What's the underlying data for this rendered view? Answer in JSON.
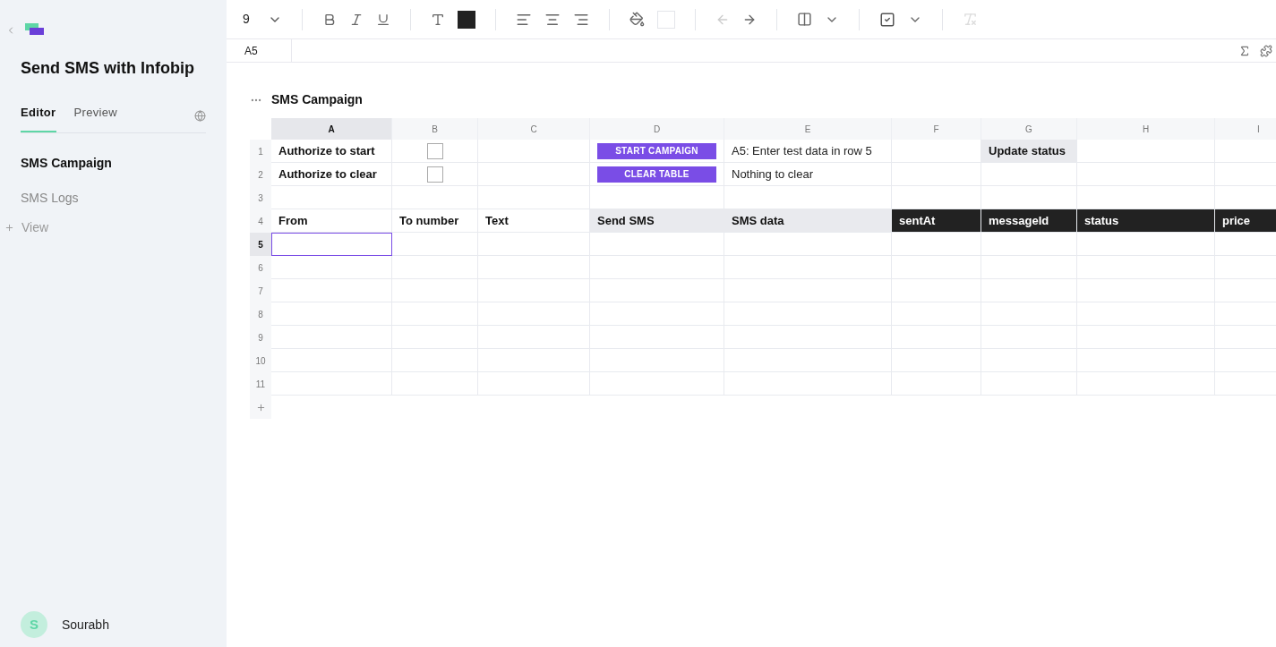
{
  "sidebar": {
    "title": "Send SMS with Infobip",
    "tabs": [
      {
        "label": "Editor",
        "selected": true
      },
      {
        "label": "Preview",
        "selected": false
      }
    ],
    "pages": [
      {
        "label": "SMS Campaign",
        "selected": true
      },
      {
        "label": "SMS Logs",
        "selected": false
      }
    ],
    "add_view": "View",
    "user": {
      "initial": "S",
      "name": "Sourabh"
    }
  },
  "toolbar": {
    "font_size": "9"
  },
  "formula_bar": {
    "cell_ref": "A5"
  },
  "sheet": {
    "title": "SMS Campaign",
    "columns": [
      {
        "label": "A",
        "selected": true
      },
      {
        "label": "B",
        "selected": false
      },
      {
        "label": "C",
        "selected": false
      },
      {
        "label": "D",
        "selected": false
      },
      {
        "label": "E",
        "selected": false
      },
      {
        "label": "F",
        "selected": false
      },
      {
        "label": "G",
        "selected": false
      },
      {
        "label": "H",
        "selected": false
      },
      {
        "label": "I",
        "selected": false
      }
    ],
    "rows": [
      {
        "number": "1",
        "selected": false,
        "cells": [
          {
            "kind": "bold",
            "text": "Authorize to start"
          },
          {
            "kind": "checkbox",
            "checked": false
          },
          {
            "kind": "plain"
          },
          {
            "kind": "button",
            "text": "START CAMPAIGN"
          },
          {
            "kind": "plain",
            "text": "A5: Enter test data in row 5"
          },
          {
            "kind": "plain"
          },
          {
            "kind": "shaded",
            "text": "Update status"
          },
          {
            "kind": "plain"
          },
          {
            "kind": "plain"
          }
        ]
      },
      {
        "number": "2",
        "selected": false,
        "cells": [
          {
            "kind": "bold",
            "text": "Authorize to clear"
          },
          {
            "kind": "checkbox",
            "checked": false
          },
          {
            "kind": "plain"
          },
          {
            "kind": "button",
            "text": "CLEAR TABLE"
          },
          {
            "kind": "plain",
            "text": "Nothing to clear"
          },
          {
            "kind": "plain"
          },
          {
            "kind": "plain"
          },
          {
            "kind": "plain"
          },
          {
            "kind": "plain"
          }
        ]
      },
      {
        "number": "3",
        "selected": false,
        "cells": []
      },
      {
        "number": "4",
        "selected": false,
        "cells": [
          {
            "kind": "bold",
            "text": "From"
          },
          {
            "kind": "bold",
            "text": "To number"
          },
          {
            "kind": "bold",
            "text": "Text"
          },
          {
            "kind": "shaded",
            "text": "Send SMS"
          },
          {
            "kind": "shaded",
            "text": "SMS data"
          },
          {
            "kind": "dark",
            "text": "sentAt"
          },
          {
            "kind": "dark",
            "text": "messageId"
          },
          {
            "kind": "dark",
            "text": "status"
          },
          {
            "kind": "dark",
            "text": "price"
          }
        ]
      },
      {
        "number": "5",
        "selected": true,
        "cells": [
          {
            "kind": "plain",
            "selected": true
          }
        ]
      },
      {
        "number": "6",
        "selected": false,
        "cells": []
      },
      {
        "number": "7",
        "selected": false,
        "cells": []
      },
      {
        "number": "8",
        "selected": false,
        "cells": []
      },
      {
        "number": "9",
        "selected": false,
        "cells": []
      },
      {
        "number": "10",
        "selected": false,
        "cells": []
      },
      {
        "number": "11",
        "selected": false,
        "cells": []
      }
    ]
  }
}
